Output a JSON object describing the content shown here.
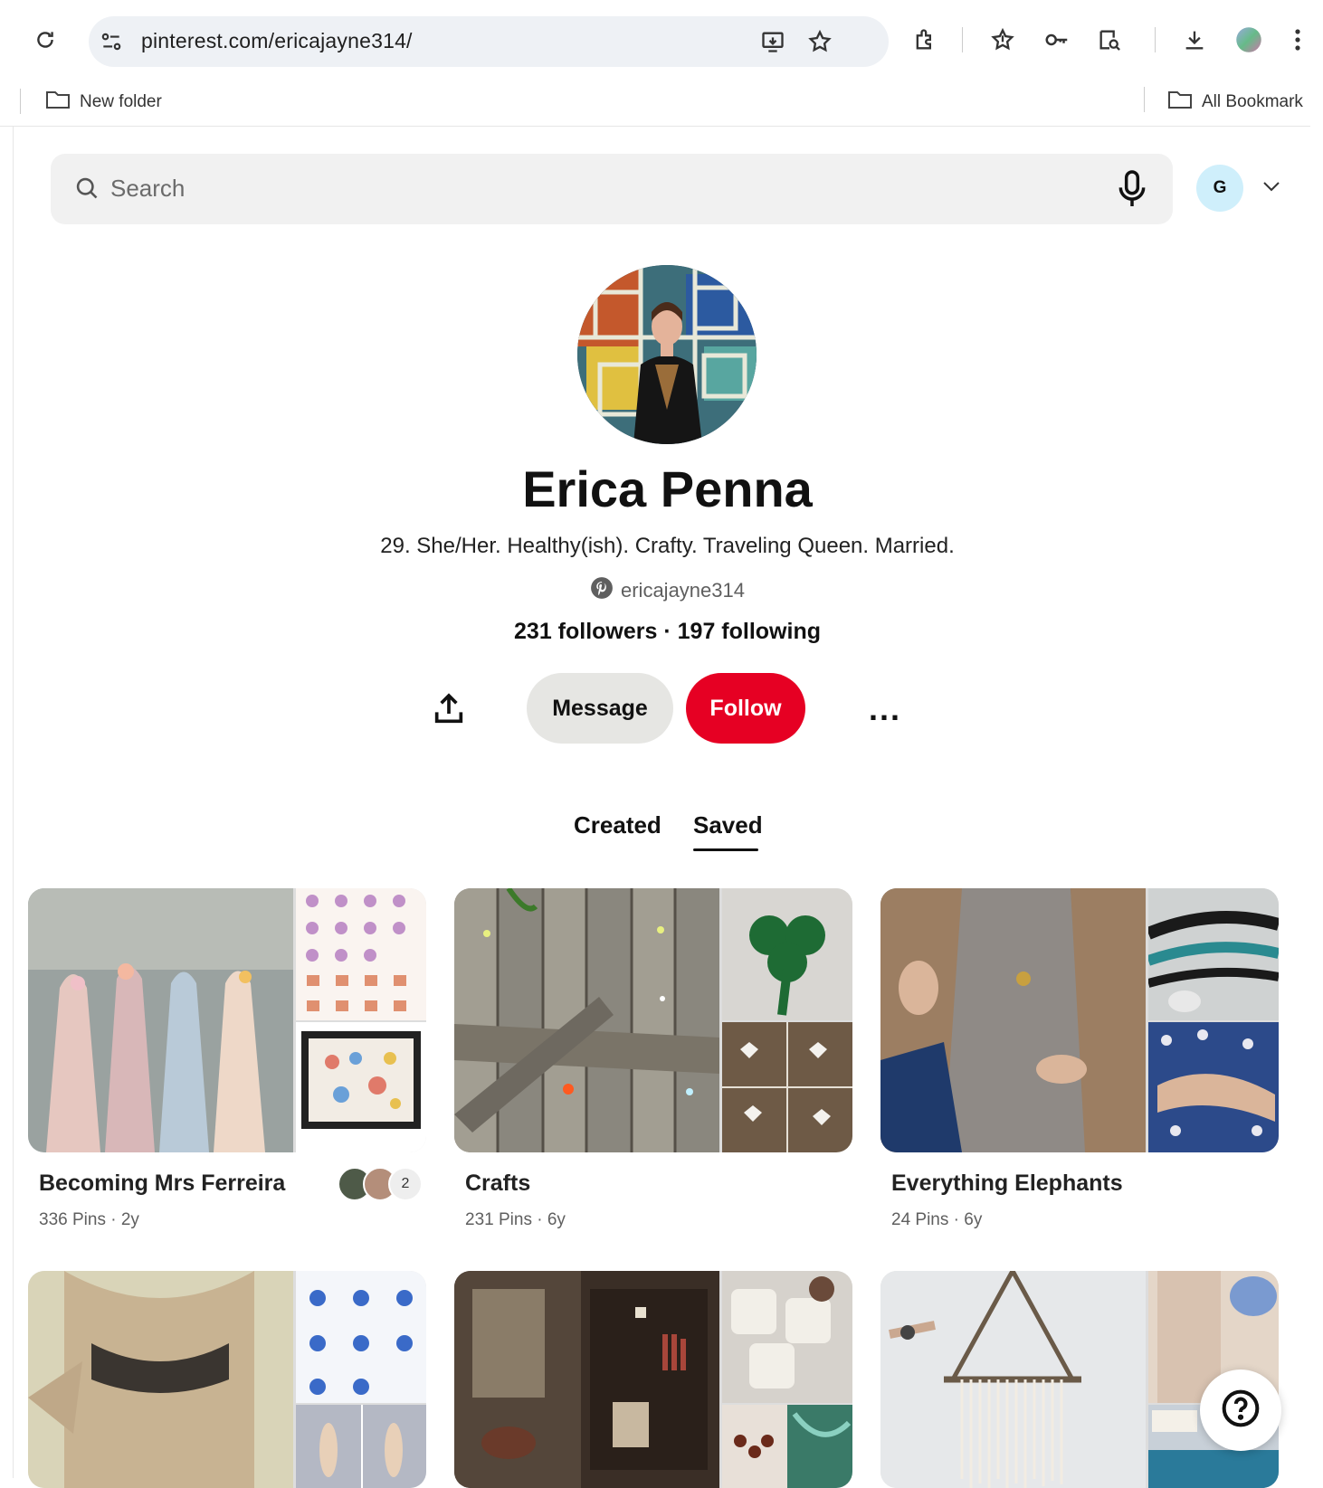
{
  "browser": {
    "url": "pinterest.com/ericajayne314/",
    "bookmarks": {
      "new_folder": "New folder",
      "all_bookmarks": "All Bookmark"
    }
  },
  "header": {
    "search_placeholder": "Search",
    "account_initial": "G"
  },
  "profile": {
    "name": "Erica Penna",
    "bio": "29. She/Her. Healthy(ish). Crafty. Traveling Queen. Married.",
    "handle": "ericajayne314",
    "stats": "231 followers · 197 following"
  },
  "actions": {
    "message": "Message",
    "follow": "Follow",
    "more": "..."
  },
  "tabs": [
    {
      "label": "Created",
      "active": false
    },
    {
      "label": "Saved",
      "active": true
    }
  ],
  "boards": [
    {
      "title": "Becoming Mrs Ferreira",
      "meta": "336 Pins · 2y",
      "collaborators": "2"
    },
    {
      "title": "Crafts",
      "meta": "231 Pins · 6y"
    },
    {
      "title": "Everything Elephants",
      "meta": "24 Pins · 6y"
    }
  ],
  "colors": {
    "follow": "#e60023",
    "message_bg": "#e6e6e3",
    "search_bg": "#f1f1f1"
  },
  "icons": [
    "reload-icon",
    "site-settings-icon",
    "install-icon",
    "star-icon",
    "extensions-icon",
    "bookmark-star-icon",
    "password-key-icon",
    "reading-mode-icon",
    "download-icon",
    "profile-icon",
    "menu-kebab-icon",
    "folder-icon",
    "search-icon",
    "microphone-icon",
    "chevron-down-icon",
    "pinterest-logo-icon",
    "share-icon",
    "help-icon"
  ]
}
